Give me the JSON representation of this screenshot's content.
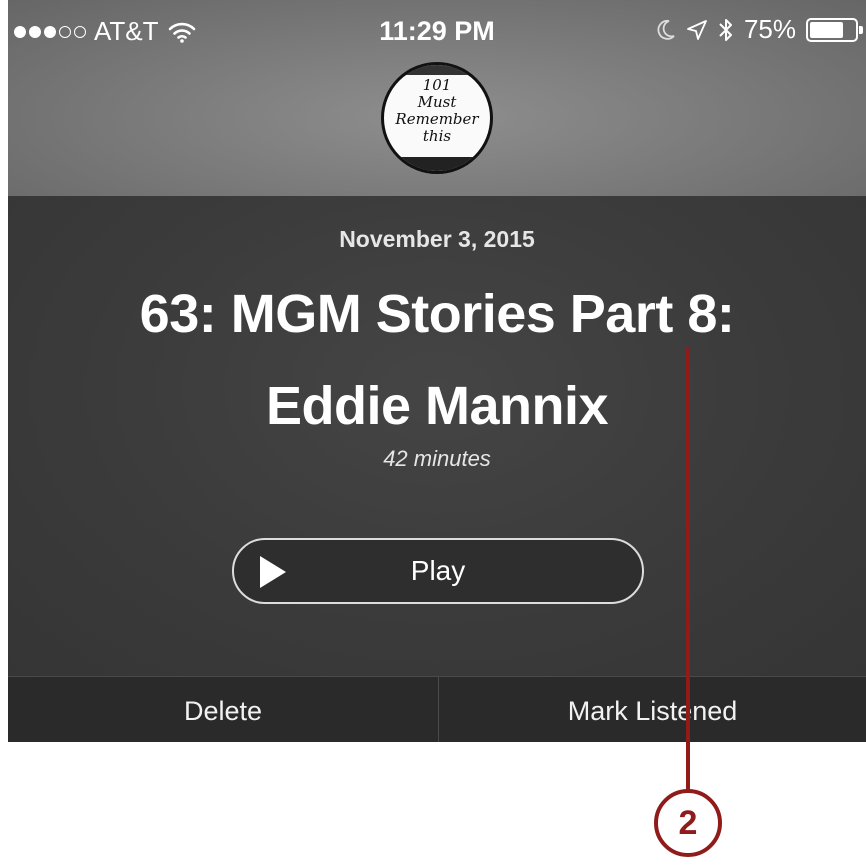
{
  "status_bar": {
    "signal_bars": 3,
    "signal_total": 5,
    "carrier": "AT&T",
    "time": "11:29 PM",
    "battery": "75%",
    "battery_level": 0.75
  },
  "podcast": {
    "artwork_text": [
      "101",
      "Must",
      "Remember",
      "this"
    ]
  },
  "episode": {
    "date": "November 3, 2015",
    "title_line1": "63: MGM Stories Part 8:",
    "title_line2": "Eddie Mannix",
    "duration": "42 minutes"
  },
  "controls": {
    "play_label": "Play",
    "delete_label": "Delete",
    "mark_listened_label": "Mark Listened"
  },
  "callout": {
    "number": "2"
  },
  "colors": {
    "callout": "#8f1b1b"
  }
}
